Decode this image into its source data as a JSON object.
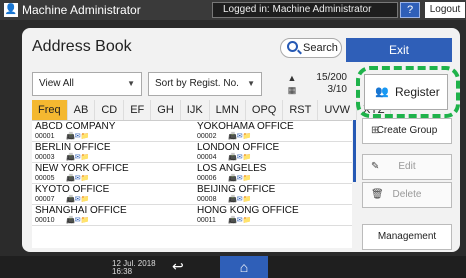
{
  "topbar": {
    "user_label": "Machine Administrator",
    "logged_in": "Logged in: Machine Administrator",
    "help": "?",
    "logout": "Logout"
  },
  "header": {
    "title": "Address Book",
    "search_label": "Search",
    "exit_label": "Exit"
  },
  "filters": {
    "view": "View All",
    "sort": "Sort by Regist. No.",
    "page_current": "15/200",
    "page_sub": "3/10"
  },
  "tabs": [
    "Freq",
    "AB",
    "CD",
    "EF",
    "GH",
    "IJK",
    "LMN",
    "OPQ",
    "RST",
    "UVW",
    "XYZ"
  ],
  "entries": [
    {
      "name": "ABCD COMPANY",
      "num": "00001"
    },
    {
      "name": "YOKOHAMA OFFICE",
      "num": "00002"
    },
    {
      "name": "BERLIN OFFICE",
      "num": "00003"
    },
    {
      "name": "LONDON OFFICE",
      "num": "00004"
    },
    {
      "name": "NEW YORK OFFICE",
      "num": "00005"
    },
    {
      "name": "LOS ANGELES",
      "num": "00006"
    },
    {
      "name": "KYOTO OFFICE",
      "num": "00007"
    },
    {
      "name": "BEIJING OFFICE",
      "num": "00008"
    },
    {
      "name": "SHANGHAI OFFICE",
      "num": "00010"
    },
    {
      "name": "HONG KONG OFFICE",
      "num": "00011"
    }
  ],
  "side": {
    "register": "Register",
    "create_group": "Create Group",
    "edit": "Edit",
    "delete": "Delete",
    "management": "Management"
  },
  "footer": {
    "date": "12 Jul. 2018",
    "time": "16:38"
  },
  "colors": {
    "accent": "#2f5fb8",
    "active_tab": "#f4b830",
    "highlight": "#1eb24a"
  }
}
